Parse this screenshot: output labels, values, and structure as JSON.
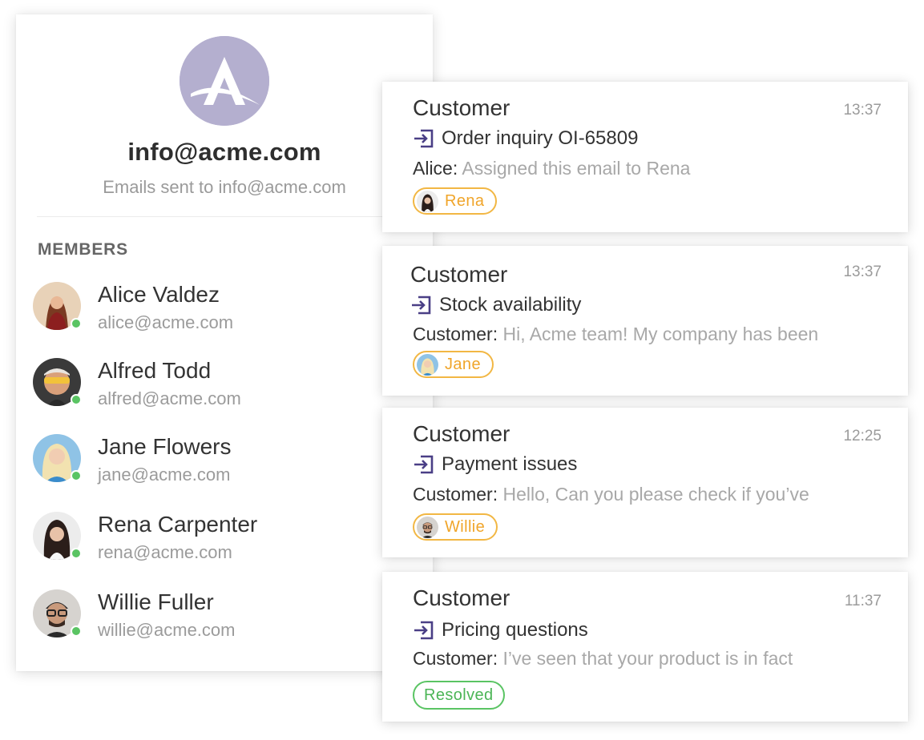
{
  "inbox": {
    "title": "info@acme.com",
    "subtitle": "Emails sent to info@acme.com",
    "avatar_color": "#b4afcf",
    "avatar_icon": "acme-logo-icon"
  },
  "members": {
    "heading": "MEMBERS",
    "status_color": "#5ac463",
    "items": [
      {
        "name": "Alice Valdez",
        "email": "alice@acme.com",
        "status": "online"
      },
      {
        "name": "Alfred Todd",
        "email": "alfred@acme.com",
        "status": "online"
      },
      {
        "name": "Jane Flowers",
        "email": "jane@acme.com",
        "status": "online"
      },
      {
        "name": "Rena Carpenter",
        "email": "rena@acme.com",
        "status": "online"
      },
      {
        "name": "Willie Fuller",
        "email": "willie@acme.com",
        "status": "online"
      }
    ]
  },
  "conversations": {
    "accent_color": "#4a3f86",
    "assignee_color": "#f2b744",
    "resolved_color": "#5ac463",
    "items": [
      {
        "from": "Customer",
        "time": "13:37",
        "subject": "Order inquiry OI-65809",
        "preview_author": "Alice:",
        "preview_text": "Assigned this email to Rena",
        "tag": "Rena",
        "tag_type": "assignee"
      },
      {
        "from": "Customer",
        "time": "13:37",
        "subject": "Stock availability",
        "preview_author": "Customer:",
        "preview_text": "Hi, Acme team! My company has been",
        "tag": "Jane",
        "tag_type": "assignee"
      },
      {
        "from": "Customer",
        "time": "12:25",
        "subject": "Payment issues",
        "preview_author": "Customer:",
        "preview_text": "Hello, Can you please check if you’ve",
        "tag": "Willie",
        "tag_type": "assignee"
      },
      {
        "from": "Customer",
        "time": "11:37",
        "subject": "Pricing questions",
        "preview_author": "Customer:",
        "preview_text": "I’ve seen that your product is in fact",
        "tag": "Resolved",
        "tag_type": "status"
      }
    ]
  }
}
